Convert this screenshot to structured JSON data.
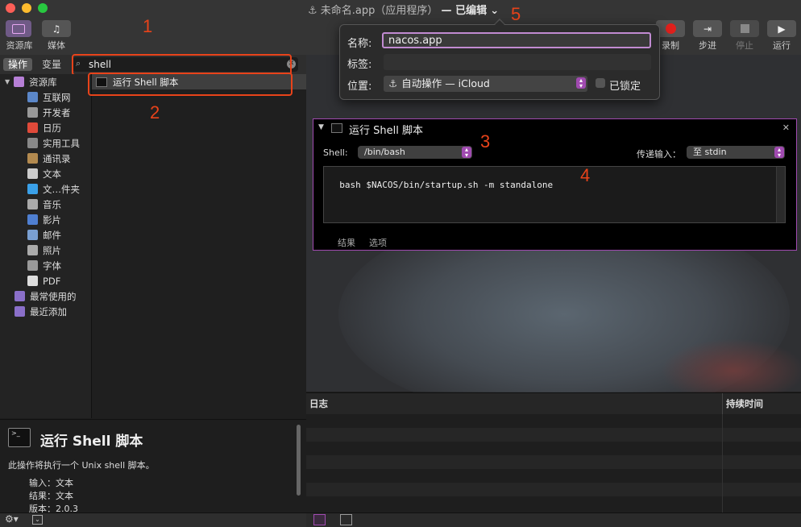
{
  "window": {
    "title_prefix": "未命名.app（应用程序）",
    "title_suffix": "— 已编辑",
    "title_chevron": "⌄"
  },
  "toolbar": {
    "library_label": "资源库",
    "media_label": "媒体",
    "record_label": "录制",
    "step_label": "步进",
    "stop_label": "停止",
    "run_label": "运行"
  },
  "annotations": [
    "1",
    "2",
    "3",
    "4",
    "5"
  ],
  "left": {
    "tab_actions": "操作",
    "tab_variables": "变量",
    "search_value": "shell",
    "library_items": [
      {
        "label": "资源库",
        "icon": "library-icon"
      },
      {
        "label": "互联网",
        "icon": "globe-icon"
      },
      {
        "label": "开发者",
        "icon": "tools-icon"
      },
      {
        "label": "日历",
        "icon": "calendar-icon"
      },
      {
        "label": "实用工具",
        "icon": "utilities-icon"
      },
      {
        "label": "通讯录",
        "icon": "contacts-icon"
      },
      {
        "label": "文本",
        "icon": "text-icon"
      },
      {
        "label": "文…件夹",
        "icon": "finder-icon"
      },
      {
        "label": "音乐",
        "icon": "music-icon"
      },
      {
        "label": "影片",
        "icon": "movie-icon"
      },
      {
        "label": "邮件",
        "icon": "mail-icon"
      },
      {
        "label": "照片",
        "icon": "photos-icon"
      },
      {
        "label": "字体",
        "icon": "font-icon"
      },
      {
        "label": "PDF",
        "icon": "pdf-icon"
      },
      {
        "label": "最常使用的",
        "icon": "folder-icon"
      },
      {
        "label": "最近添加",
        "icon": "folder-icon"
      }
    ],
    "result_item": "运行 Shell 脚本"
  },
  "description": {
    "title": "运行 Shell 脚本",
    "text": "此操作将执行一个 Unix shell 脚本。",
    "input": "输入：文本",
    "result": "结果：文本",
    "version": "版本：2.0.3"
  },
  "action": {
    "title": "运行 Shell 脚本",
    "shell_label": "Shell:",
    "shell_value": "/bin/bash",
    "pass_input_label": "传递输入：",
    "pass_input_value": "至 stdin",
    "script": "bash $NACOS/bin/startup.sh -m standalone",
    "tab_results": "结果",
    "tab_options": "选项"
  },
  "log": {
    "col_log": "日志",
    "col_duration": "持续时间"
  },
  "popover": {
    "name_label": "名称:",
    "name_value": "nacos.app",
    "tags_label": "标签:",
    "location_label": "位置:",
    "location_value": "自动操作 — iCloud",
    "locked_label": "已锁定"
  },
  "colors": {
    "accent": "#a04ab0",
    "annotation": "#e8431a",
    "record": "#e0201c"
  }
}
